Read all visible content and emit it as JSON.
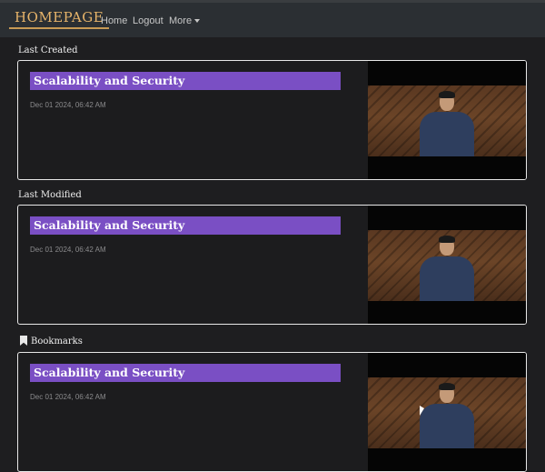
{
  "nav": {
    "brand": "HOMEPAGE",
    "links": [
      "Home",
      "Logout"
    ],
    "more_label": "More"
  },
  "sections": [
    {
      "title": "Last Created",
      "card": {
        "title": "Scalability and Security",
        "date": "Dec 01 2024, 06:42 AM"
      }
    },
    {
      "title": "Last Modified",
      "card": {
        "title": "Scalability and Security",
        "date": "Dec 01 2024, 06:42 AM"
      }
    },
    {
      "title": "Bookmarks",
      "icon": "bookmark-icon",
      "card": {
        "title": "Scalability and Security",
        "date": "Dec 01 2024, 06:42 AM"
      }
    }
  ],
  "colors": {
    "brand": "#e7b46a",
    "card_title_bg": "#7a4fc4",
    "background": "#1e1e20"
  }
}
